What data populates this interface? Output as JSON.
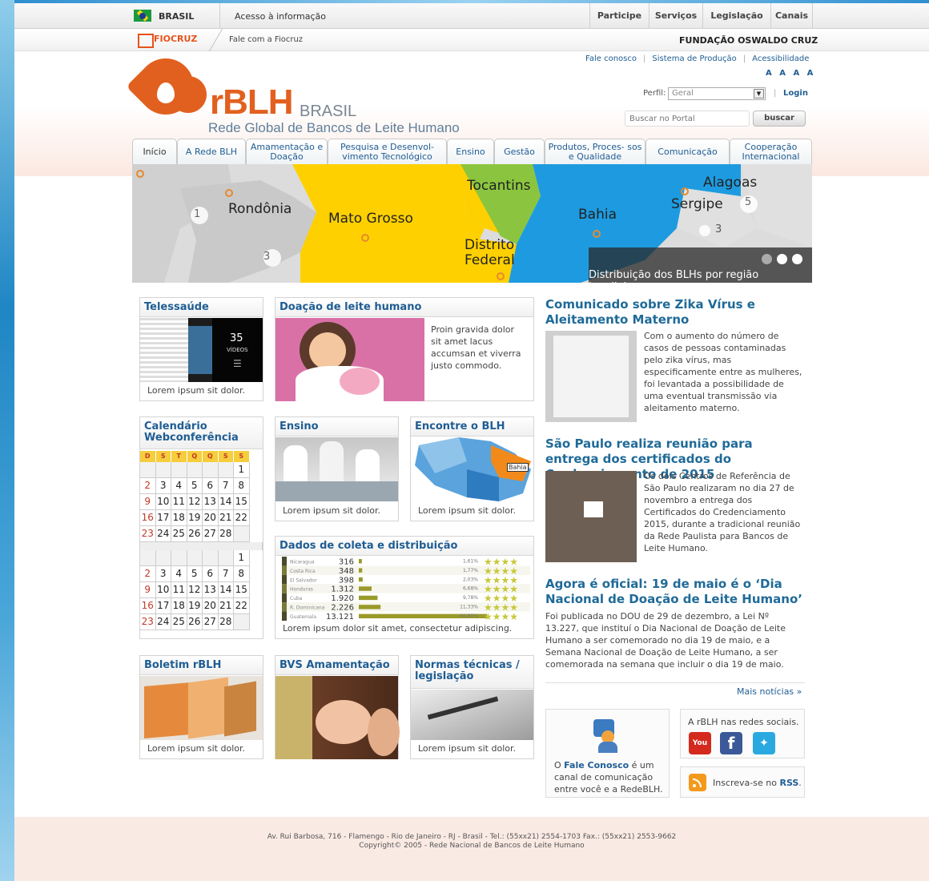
{
  "gov_bar": {
    "brasil": "BRASIL",
    "acesso": "Acesso à informação",
    "menu": [
      "Participe",
      "Serviços",
      "Legislação",
      "Canais"
    ]
  },
  "fio_bar": {
    "logo": "FIOCRUZ",
    "fale": "Fale com a Fiocruz",
    "title": "FUNDAÇÃO OSWALDO CRUZ"
  },
  "header": {
    "links": [
      "Fale conosco",
      "Sistema de Produção",
      "Acessibilidade"
    ],
    "font_sizes": "A A A A",
    "brand": "rBLH",
    "brand_sub": "BRASIL",
    "tagline": "Rede Global de Bancos de Leite Humano",
    "perfil_label": "Perfil:",
    "perfil_value": "Geral",
    "login": "Login",
    "search_placeholder": "Buscar no Portal",
    "search_button": "buscar"
  },
  "nav": [
    "Início",
    "A Rede BLH",
    "Amamentação e Doação",
    "Pesquisa e Desenvol- vimento Tecnológico",
    "Ensino",
    "Gestão",
    "Produtos, Proces- sos e Qualidade",
    "Comunicação",
    "Cooperação Internacional"
  ],
  "banner": {
    "states": [
      "Rondônia",
      "Mato Grosso",
      "Tocantins",
      "Distrito Federal",
      "Bahia",
      "Alagoas",
      "Sergipe"
    ],
    "markers": [
      "1",
      "3",
      "5",
      "3"
    ],
    "caption": "Distribuição dos BLHs por região brasileira"
  },
  "boxes": {
    "telessaude": {
      "title": "Telessaúde",
      "caption": "Lorem ipsum sit dolor.",
      "video_count": "35",
      "video_label": "VÍDEOS"
    },
    "doacao": {
      "title": "Doação de leite humano",
      "text": "Proin gravida dolor sit amet lacus accumsan et viverra justo commodo."
    },
    "calendario": {
      "title": "Calendário Webconferência",
      "days": [
        "D",
        "S",
        "T",
        "Q",
        "Q",
        "S",
        "S"
      ]
    },
    "ensino": {
      "title": "Ensino",
      "caption": "Lorem ipsum sit dolor."
    },
    "encontre": {
      "title": "Encontre o BLH",
      "caption": "Lorem ipsum sit dolor.",
      "map_label": "Bahia"
    },
    "dados": {
      "title": "Dados de coleta e distribuição",
      "caption": "Lorem ipsum dolor sit amet, consectetur adipiscing."
    },
    "boletim": {
      "title": "Boletim rBLH",
      "caption": "Lorem ipsum sit dolor."
    },
    "bvs": {
      "title": "BVS Amamentação"
    },
    "normas": {
      "title": "Normas técnicas / legislação",
      "caption": "Lorem ipsum sit dolor."
    }
  },
  "calendar": {
    "month1": [
      [
        "",
        "",
        "",
        "",
        "",
        "",
        "1"
      ],
      [
        "2",
        "3",
        "4",
        "5",
        "6",
        "7",
        "8"
      ],
      [
        "9",
        "10",
        "11",
        "12",
        "13",
        "14",
        "15"
      ],
      [
        "16",
        "17",
        "18",
        "19",
        "20",
        "21",
        "22"
      ],
      [
        "23",
        "24",
        "25",
        "26",
        "27",
        "28",
        ""
      ]
    ],
    "month2": [
      [
        "",
        "",
        "",
        "",
        "",
        "",
        "1"
      ],
      [
        "2",
        "3",
        "4",
        "5",
        "6",
        "7",
        "8"
      ],
      [
        "9",
        "10",
        "11",
        "12",
        "13",
        "14",
        "15"
      ],
      [
        "16",
        "17",
        "18",
        "19",
        "20",
        "21",
        "22"
      ],
      [
        "23",
        "24",
        "25",
        "26",
        "27",
        "28",
        ""
      ]
    ]
  },
  "chart_data": {
    "type": "table",
    "rows": [
      {
        "country": "Nicaragua",
        "value": "316",
        "pct": "1,61%"
      },
      {
        "country": "Costa Rica",
        "value": "348",
        "pct": "1,77%"
      },
      {
        "country": "El Salvador",
        "value": "398",
        "pct": "2,03%"
      },
      {
        "country": "Honduras",
        "value": "1.312",
        "pct": "6,68%"
      },
      {
        "country": "Cuba",
        "value": "1.920",
        "pct": "9,78%"
      },
      {
        "country": "R. Dominicana",
        "value": "2.226",
        "pct": "11,33%"
      },
      {
        "country": "Guatemala",
        "value": "13.121",
        "pct": "66,80%"
      }
    ],
    "values": [
      316,
      348,
      398,
      1312,
      1920,
      2226,
      13121
    ],
    "colors": {
      "bar": "#9a9a2a",
      "stars": "#c8c83a"
    }
  },
  "news": [
    {
      "title": "Comunicado sobre Zika Vírus e Aleitamento Materno",
      "text": "Com o aumento do número de casos de pessoas contaminadas pelo zika vírus, mas especificamente entre as mulheres, foi levantada a possibilidade de uma eventual transmissão via aleitamento materno."
    },
    {
      "title": "São Paulo realiza reunião para entrega dos certificados do Credenciamento de 2015",
      "text": "Os dois Centros de Referência de São Paulo realizaram no dia 27 de novembro a entrega dos Certificados do Credenciamento 2015, durante a tradicional reunião da Rede Paulista para Bancos de Leite Humano."
    },
    {
      "title": "Agora é oficial: 19 de maio é o ‘Dia Nacional de Doação de Leite Humano’",
      "text": "Foi publicada no DOU de 29 de dezembro, a Lei Nº 13.227, que instituí o Dia Nacional de Doação de Leite Humano a ser comemorado no dia 19 de maio, e a Semana Nacional de Doação de Leite Humano, a ser comemorada na semana que incluir o dia 19 de maio."
    }
  ],
  "more_news": "Mais notícias »",
  "fale_box": {
    "prefix": "O ",
    "link": "Fale Conosco",
    "suffix": " é um canal de comunicação entre você e a RedeBLH."
  },
  "social": {
    "title": "A rBLH nas redes sociais."
  },
  "rss": {
    "prefix": "Inscreva-se no ",
    "link": "RSS",
    "suffix": "."
  },
  "footer": {
    "address": "Av. Rui Barbosa, 716 - Flamengo - Rio de Janeiro - RJ - Brasil - Tel.: (55xx21) 2554-1703 Fax.: (55xx21) 2553-9662",
    "copyright": "Copyright© 2005 - Rede Nacional de Bancos de Leite Humano"
  },
  "colors": {
    "accent": "#e2601f",
    "link": "#1f5d93"
  }
}
